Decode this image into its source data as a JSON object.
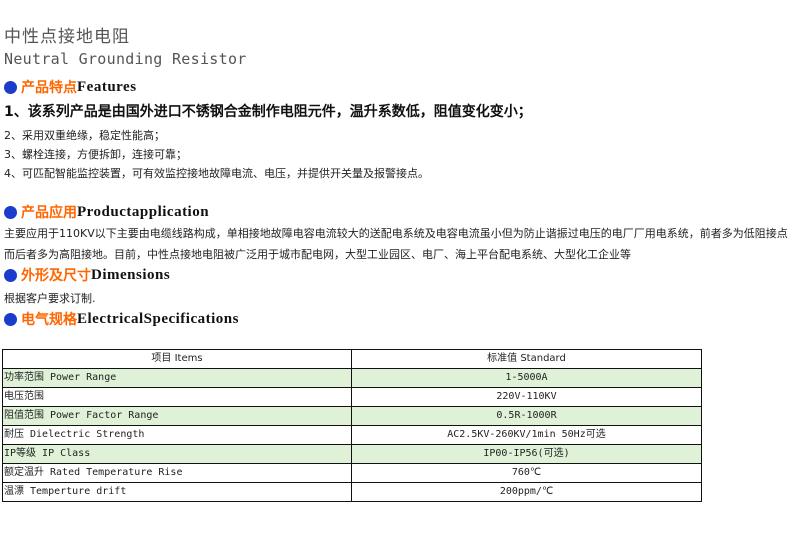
{
  "page": {
    "title_cn": "中性点接地电阻",
    "title_en": "Neutral Grounding Resistor"
  },
  "sections": {
    "features": {
      "title_cn": "产品特点",
      "title_en": "Features",
      "lead": "1、该系列产品是由国外进口不锈钢合金制作电阻元件，温升系数低，阻值变化变小；",
      "items": [
        "2、采用双重绝缘，稳定性能高；",
        "3、螺栓连接，方便拆卸，连接可靠；",
        "4、可匹配智能监控装置，可有效监控接地故障电流、电压，并提供开关量及报警接点。"
      ]
    },
    "application": {
      "title_cn": "产品应用",
      "title_en": "Productapplication",
      "text": "主要应用于110KV以下主要由电缆线路构成，单相接地故障电容电流较大的送配电系统及电容电流虽小但为防止谐振过电压的电厂厂用电系统，前者多为低阻接点而后者多为高阻接地。目前，中性点接地电阻被广泛用于城市配电网，大型工业园区、电厂、海上平台配电系统、大型化工企业等"
    },
    "dimensions": {
      "title_cn": "外形及尺寸",
      "title_en": "Dimensions",
      "text": "根据客户要求订制."
    },
    "electrical": {
      "title_cn": "电气规格",
      "title_en": "ElectricalSpecifications"
    }
  },
  "spec_table": {
    "headers": [
      "项目 Items",
      "标准值 Standard"
    ],
    "rows": [
      {
        "item": "功率范围 Power Range",
        "value": "1-5000A"
      },
      {
        "item": "电压范围",
        "value": "220V-110KV"
      },
      {
        "item": "阻值范围 Power Factor Range",
        "value": "0.5R-1000R"
      },
      {
        "item": "耐压 Dielectric Strength",
        "value": "AC2.5KV-260KV/1min 50Hz可选"
      },
      {
        "item": "IP等级 IP Class",
        "value": "IP00-IP56(可选)"
      },
      {
        "item": "额定温升 Rated Temperature Rise",
        "value": "760℃"
      },
      {
        "item": "温漂 Temperture drift",
        "value": "200ppm/℃"
      }
    ]
  },
  "colors": {
    "bullet": "#1c3ccc",
    "section_cn": "#ff6600",
    "row_tint": "#dff2d8"
  }
}
